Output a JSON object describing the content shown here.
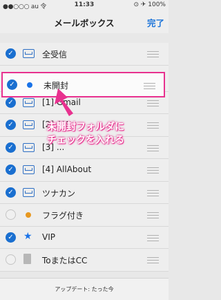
{
  "statusbar": {
    "carrier": "●●○○○ au 令",
    "time": "11:33",
    "battery_status": "⊙ ✈ 100%"
  },
  "navbar": {
    "title": "メールボックス",
    "done": "完了"
  },
  "mailboxes": [
    {
      "label": "全受信",
      "checked": true,
      "icon": "inbox-icon"
    },
    {
      "label": "未開封",
      "checked": true,
      "icon": "unread-dot-icon"
    },
    {
      "label": "[1] Gmail",
      "checked": true,
      "icon": "inbox-icon"
    },
    {
      "label": "[2] AU",
      "checked": true,
      "icon": "inbox-icon"
    },
    {
      "label": "[3] ...",
      "checked": true,
      "icon": "inbox-icon"
    },
    {
      "label": "[4] AllAbout",
      "checked": true,
      "icon": "inbox-icon"
    },
    {
      "label": "ツナカン",
      "checked": true,
      "icon": "inbox-icon"
    },
    {
      "label": "フラグ付き",
      "checked": false,
      "icon": "flag-dot-icon"
    },
    {
      "label": "VIP",
      "checked": true,
      "icon": "star-icon"
    },
    {
      "label": "ToまたはCC",
      "checked": false,
      "icon": "document-icon"
    }
  ],
  "annotation": {
    "line1": "未開封フォルダに",
    "line2": "チェックを入れる",
    "color": "#e8318f"
  },
  "toolbar": {
    "update_text": "アップデート: たった今"
  }
}
